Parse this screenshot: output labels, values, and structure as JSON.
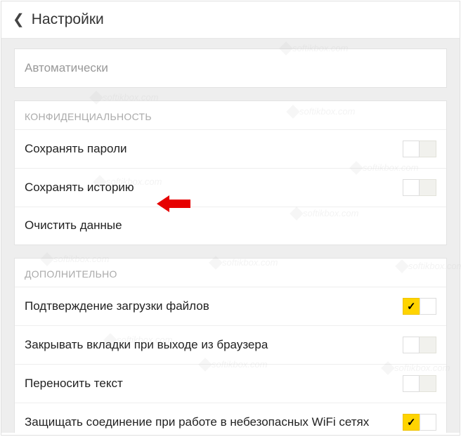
{
  "header": {
    "title": "Настройки"
  },
  "top_row": {
    "label": "Автоматически"
  },
  "privacy": {
    "section_title": "КОНФИДЕНЦИАЛЬНОСТЬ",
    "save_passwords": {
      "label": "Сохранять пароли",
      "on": false
    },
    "save_history": {
      "label": "Сохранять историю",
      "on": false
    },
    "clear_data": {
      "label": "Очистить данные"
    }
  },
  "additional": {
    "section_title": "ДОПОЛНИТЕЛЬНО",
    "confirm_downloads": {
      "label": "Подтверждение загрузки файлов",
      "on": true
    },
    "close_tabs_on_exit": {
      "label": "Закрывать вкладки при выходе из браузера",
      "on": false
    },
    "wrap_text": {
      "label": "Переносить текст",
      "on": false
    },
    "protect_wifi": {
      "label": "Защищать соединение при работе в небезопасных WiFi сетях",
      "on": true
    }
  },
  "annotation": {
    "arrow_color": "#e60000"
  },
  "watermark": {
    "text": "softikbox.com"
  }
}
